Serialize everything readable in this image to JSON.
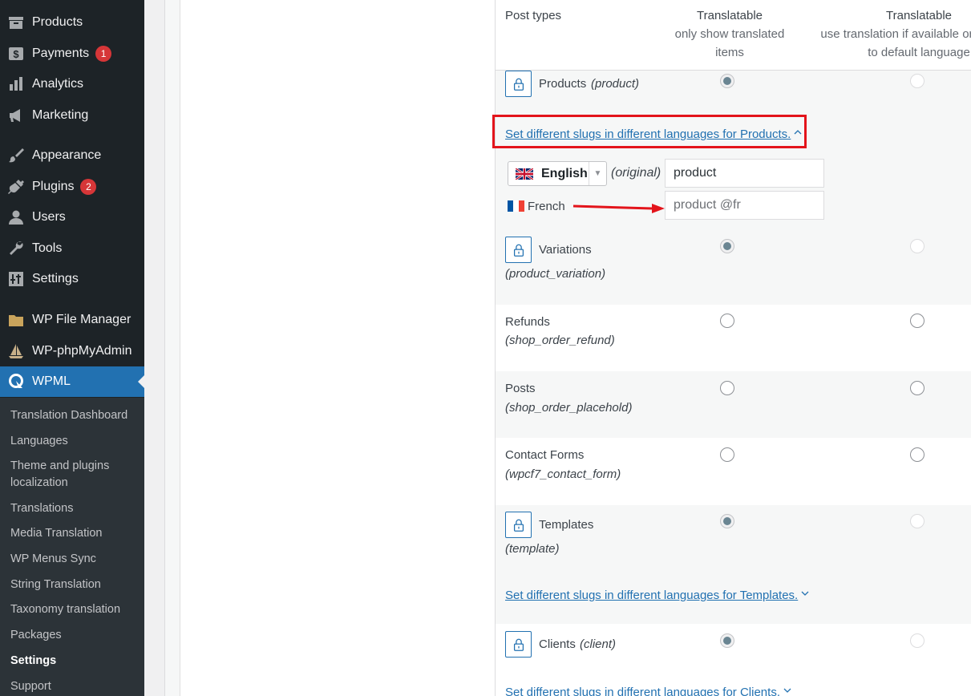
{
  "sidebar": {
    "menu": [
      {
        "label": "Products",
        "icon": "archive-icon"
      },
      {
        "label": "Payments",
        "icon": "dollar-icon",
        "badge": "1"
      },
      {
        "label": "Analytics",
        "icon": "bar-chart-icon"
      },
      {
        "label": "Marketing",
        "icon": "megaphone-icon"
      },
      {
        "label": "Appearance",
        "icon": "brush-icon"
      },
      {
        "label": "Plugins",
        "icon": "plugin-icon",
        "badge": "2"
      },
      {
        "label": "Users",
        "icon": "user-icon"
      },
      {
        "label": "Tools",
        "icon": "wrench-icon"
      },
      {
        "label": "Settings",
        "icon": "settings-icon"
      },
      {
        "label": "WP File Manager",
        "icon": "folder-icon"
      },
      {
        "label": "WP-phpMyAdmin",
        "icon": "sailboat-icon"
      },
      {
        "label": "WPML",
        "icon": "wpml-icon"
      }
    ],
    "submenu": [
      "Translation Dashboard",
      "Languages",
      "Theme and plugins localization",
      "Translations",
      "Media Translation",
      "WP Menus Sync",
      "String Translation",
      "Taxonomy translation",
      "Packages",
      "Settings",
      "Support"
    ]
  },
  "table": {
    "col_post_types": "Post types",
    "col_translatable_1_title": "Translatable",
    "col_translatable_1_desc": "only show translated items",
    "col_translatable_2_title": "Translatable",
    "col_translatable_2_desc": "use translation if available or fallback to default language",
    "rows": [
      {
        "name": "Products",
        "slug": "(product)"
      },
      {
        "name": "Variations",
        "slug": "(product_variation)"
      },
      {
        "name": "Refunds",
        "slug": "(shop_order_refund)"
      },
      {
        "name": "Posts",
        "slug": "(shop_order_placehold)"
      },
      {
        "name": "Contact Forms",
        "slug": "(wpcf7_contact_form)"
      },
      {
        "name": "Templates",
        "slug": "(template)"
      },
      {
        "name": "Clients",
        "slug": "(client)"
      }
    ],
    "slug_links": {
      "products": "Set different slugs in different languages for Products.",
      "templates": "Set different slugs in different languages for Templates.",
      "clients": "Set different slugs in different languages for Clients."
    },
    "slug_editor": {
      "language_selected": "English",
      "original_label": "(original)",
      "original_value": "product",
      "french_label": "French",
      "french_placeholder": "product @fr"
    }
  },
  "colors": {
    "sidebar_bg": "#1d2327",
    "active_menu": "#2271b1",
    "link": "#2271b1",
    "highlight": "#e3141b"
  }
}
